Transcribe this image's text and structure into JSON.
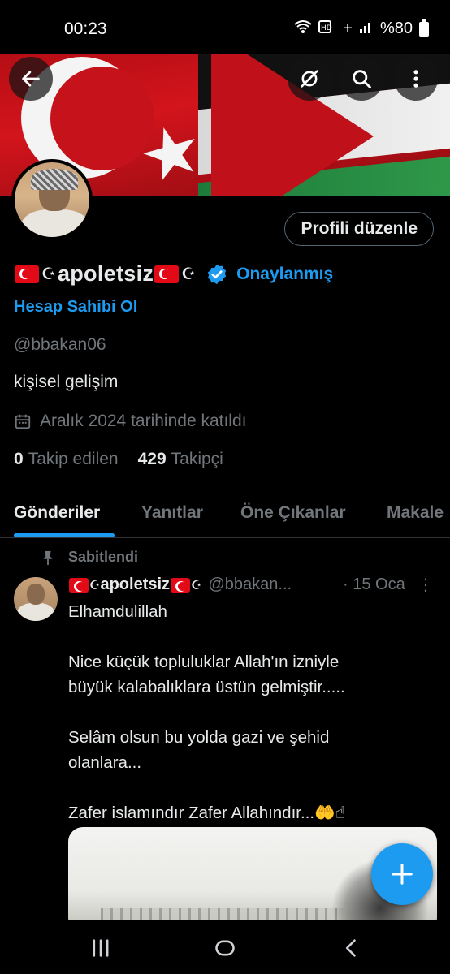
{
  "status_bar": {
    "time": "00:23",
    "network": "+",
    "battery": "%80",
    "icons": [
      "wifi-calling-icon",
      "hd-volte-icon",
      "signal-icon",
      "battery-icon"
    ]
  },
  "header": {
    "back_icon": "arrow-left-icon",
    "grok_icon": "grok-icon",
    "search_icon": "search-icon",
    "more_icon": "more-vertical-icon"
  },
  "profile": {
    "edit_button": "Profili düzenle",
    "display_name": "apoletsiz",
    "verified_label": "Onaylanmış",
    "ownership_link": "Hesap Sahibi Ol",
    "handle": "@bbakan06",
    "bio": "kişisel gelişim",
    "joined": "Aralık 2024 tarihinde katıldı",
    "following_count": "0",
    "following_label": "Takip edilen",
    "followers_count": "429",
    "followers_label": "Takipçi"
  },
  "tabs": [
    {
      "label": "Gönderiler",
      "active": true
    },
    {
      "label": "Yanıtlar",
      "active": false
    },
    {
      "label": "Öne Çıkanlar",
      "active": false
    },
    {
      "label": "Makale",
      "active": false
    }
  ],
  "pinned_post": {
    "pinned_label": "Sabitlendi",
    "author_name": "apoletsiz",
    "author_handle": "@bbakan...",
    "date": "· 15 Oca",
    "more": "⋮",
    "lines": [
      "Elhamdulillah",
      "",
      "Nice küçük topluluklar Allah'ın izniyle",
      "büyük kalabalıklara üstün gelmiştir.....",
      "",
      "Selâm olsun bu yolda  gazi ve şehid",
      "olanlara...",
      "",
      "Zafer islamındır Zafer Allahındır...🤲☝"
    ]
  },
  "fab": {
    "icon": "plus-icon"
  },
  "nav_bar": {
    "icons": [
      "recent-apps-icon",
      "home-icon",
      "back-icon"
    ]
  },
  "colors": {
    "accent": "#1d9bf0",
    "background": "#000000",
    "text_primary": "#e7e9ea",
    "text_secondary": "#71767b",
    "border": "#2f3336"
  }
}
